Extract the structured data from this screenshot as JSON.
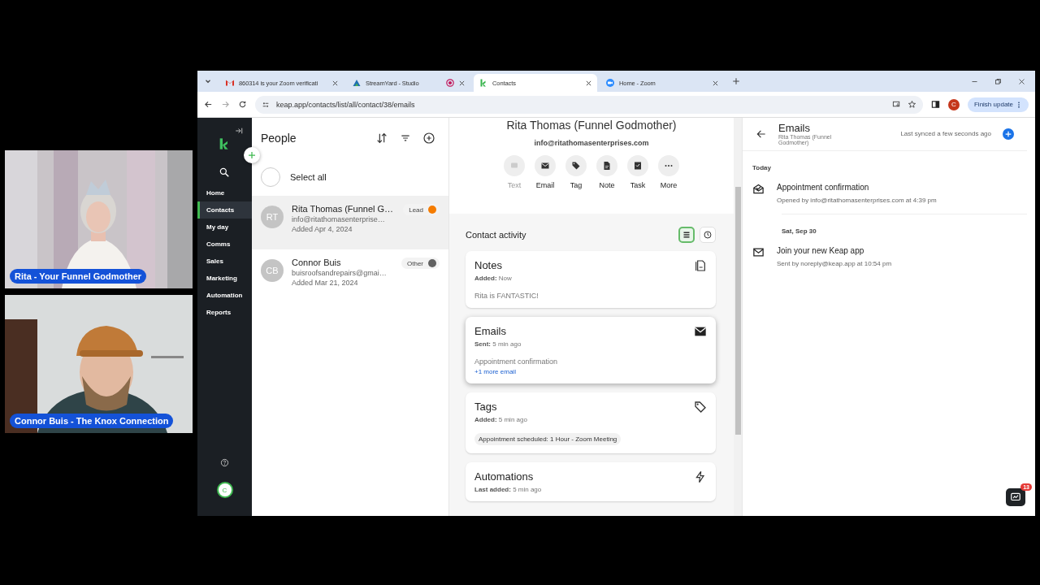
{
  "videos": [
    {
      "caption": "Rita - Your Funnel Godmother",
      "kind": "picture"
    },
    {
      "caption": "Connor Buis - The Knox Connection",
      "kind": "picture"
    }
  ],
  "browser": {
    "tabs": [
      {
        "kind": "mail",
        "title": "860314 is your Zoom verificati",
        "recording": false,
        "selected": false
      },
      {
        "kind": "streamyard",
        "title": "StreamYard - Studio",
        "recording": true,
        "selected": false
      },
      {
        "kind": "keap",
        "title": "Contacts",
        "recording": false,
        "selected": true
      },
      {
        "kind": "zoom",
        "title": "Home - Zoom",
        "recording": false,
        "selected": false
      }
    ],
    "url": "keap.app/contacts/list/all/contact/38/emails",
    "profile_initial": "C",
    "update_button": "Finish update"
  },
  "nav": {
    "items": [
      {
        "label": "Home",
        "selected": false
      },
      {
        "label": "Contacts",
        "selected": true
      },
      {
        "label": "My day",
        "selected": false
      },
      {
        "label": "Comms",
        "selected": false
      },
      {
        "label": "Sales",
        "selected": false
      },
      {
        "label": "Marketing",
        "selected": false
      },
      {
        "label": "Automation",
        "selected": false
      },
      {
        "label": "Reports",
        "selected": false
      }
    ],
    "avatar_initial": "C"
  },
  "people": {
    "title": "People",
    "select_all": {
      "label": "Select all",
      "checked": false
    },
    "contacts": [
      {
        "initials": "RT",
        "name": "Rita Thomas (Funnel G…",
        "email": "info@ritathomasenterprise…",
        "added": "Added Apr 4, 2024",
        "tag": "Lead",
        "color": "#f57c00",
        "selected": true
      },
      {
        "initials": "CB",
        "name": "Connor Buis",
        "email": "buisroofsandrepairs@gmai…",
        "added": "Added Mar 21, 2024",
        "tag": "Other",
        "color": "#616161",
        "selected": false
      }
    ]
  },
  "detail": {
    "name": "Rita Thomas (Funnel Godmother)",
    "email": "info@ritathomasenterprises.com",
    "actions": [
      {
        "kind": "text",
        "label": "Text",
        "disabled": true
      },
      {
        "kind": "email",
        "label": "Email",
        "disabled": false
      },
      {
        "kind": "tag",
        "label": "Tag",
        "disabled": false
      },
      {
        "kind": "note",
        "label": "Note",
        "disabled": false
      },
      {
        "kind": "task",
        "label": "Task",
        "disabled": false
      },
      {
        "kind": "more",
        "label": "More",
        "disabled": false
      }
    ],
    "activity": {
      "title": "Contact activity",
      "views": [
        {
          "kind": "list",
          "selected": true
        },
        {
          "kind": "history",
          "selected": false
        }
      ],
      "cards": [
        {
          "kind": "notes",
          "title": "Notes",
          "meta": "**Added:** Now",
          "body": "Rita is FANTASTIC!",
          "selected": false
        },
        {
          "kind": "emails",
          "title": "Emails",
          "meta": "**Sent:** 5 min ago",
          "body": "Appointment confirmation",
          "link": "+1 more email",
          "selected": true
        },
        {
          "kind": "tags",
          "title": "Tags",
          "meta": "**Added:** 5 min ago",
          "chip": "Appointment scheduled: 1 Hour - Zoom Meeting",
          "selected": false
        },
        {
          "kind": "automations",
          "title": "Automations",
          "meta": "**Last added:** 5 min ago",
          "selected": false
        }
      ]
    }
  },
  "emails_panel": {
    "title": "Emails",
    "subtitle": "Rita Thomas (Funnel Godmother)",
    "sync_status": "Last synced a few seconds ago",
    "groups": [
      {
        "date": "Today",
        "items": [
          {
            "kind": "opened",
            "subject": "Appointment confirmation",
            "detail": "Opened by info@ritathomasenterprises.com at 4:39 pm"
          }
        ]
      },
      {
        "date": "Sat, Sep 30",
        "items": [
          {
            "kind": "sent",
            "subject": "Join your new Keap app",
            "detail": "Sent by noreply@keap.app at 10:54 pm"
          }
        ]
      }
    ]
  },
  "chat_badge": "13"
}
